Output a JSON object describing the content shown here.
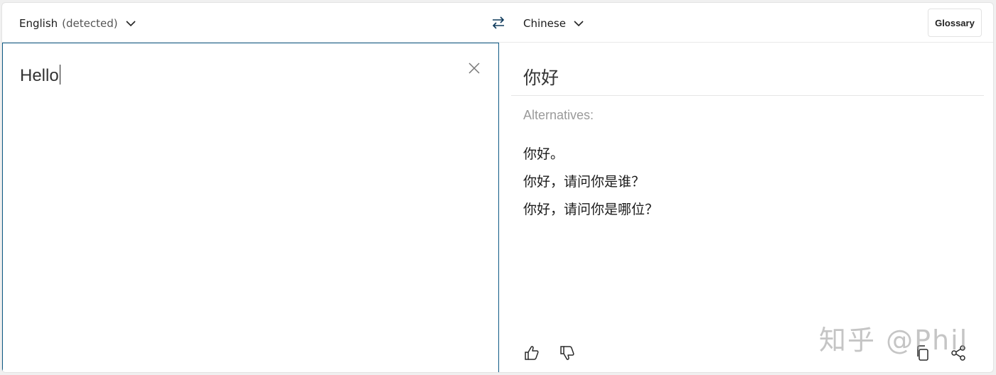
{
  "header": {
    "source_language": "English",
    "source_detected": "(detected)",
    "target_language": "Chinese",
    "glossary_label": "Glossary"
  },
  "source": {
    "text": "Hello"
  },
  "target": {
    "translation": "你好",
    "alternatives_label": "Alternatives:",
    "alternatives": [
      "你好。",
      "你好，请问你是谁？",
      "你好，请问你是哪位？"
    ]
  },
  "watermark": "知乎 @Phil",
  "colors": {
    "active_border": "#0f5a85",
    "muted_text": "#9a9a9a"
  },
  "icons": {
    "dropdown": "chevron-down-icon",
    "swap": "swap-icon",
    "clear": "close-icon",
    "thumb_up": "thumbs-up-icon",
    "thumb_down": "thumbs-down-icon",
    "copy": "copy-icon",
    "share": "share-icon"
  }
}
